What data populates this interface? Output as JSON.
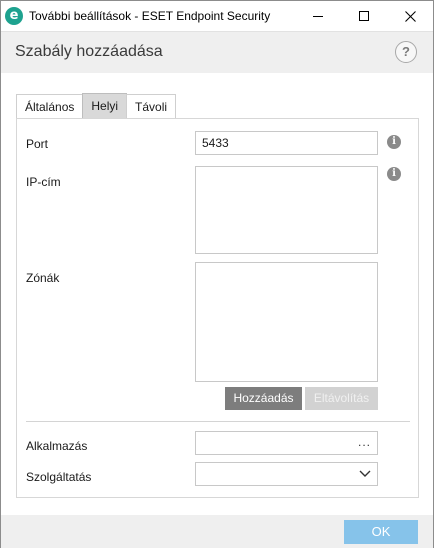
{
  "window": {
    "title": "További beállítások - ESET Endpoint Security",
    "app_icon": "eset-logo-icon",
    "icon_letter": "e"
  },
  "header": {
    "title": "Szabály hozzáadása",
    "help_label": "?"
  },
  "tabs": [
    {
      "label": "Általános",
      "active": false
    },
    {
      "label": "Helyi",
      "active": true
    },
    {
      "label": "Távoli",
      "active": false
    }
  ],
  "form": {
    "port": {
      "label": "Port",
      "value": "5433",
      "info": "i"
    },
    "ip": {
      "label": "IP-cím",
      "value": "",
      "info": "i"
    },
    "zones": {
      "label": "Zónák",
      "value": ""
    },
    "add_button": "Hozzáadás",
    "remove_button": "Eltávolítás",
    "application": {
      "label": "Alkalmazás",
      "browse": "..."
    },
    "service": {
      "label": "Szolgáltatás",
      "value": ""
    }
  },
  "footer": {
    "ok_label": "OK"
  },
  "colors": {
    "eset_teal": "#1ea28f",
    "ok_button": "#86c3ea",
    "add_button": "#7d7d7d"
  }
}
